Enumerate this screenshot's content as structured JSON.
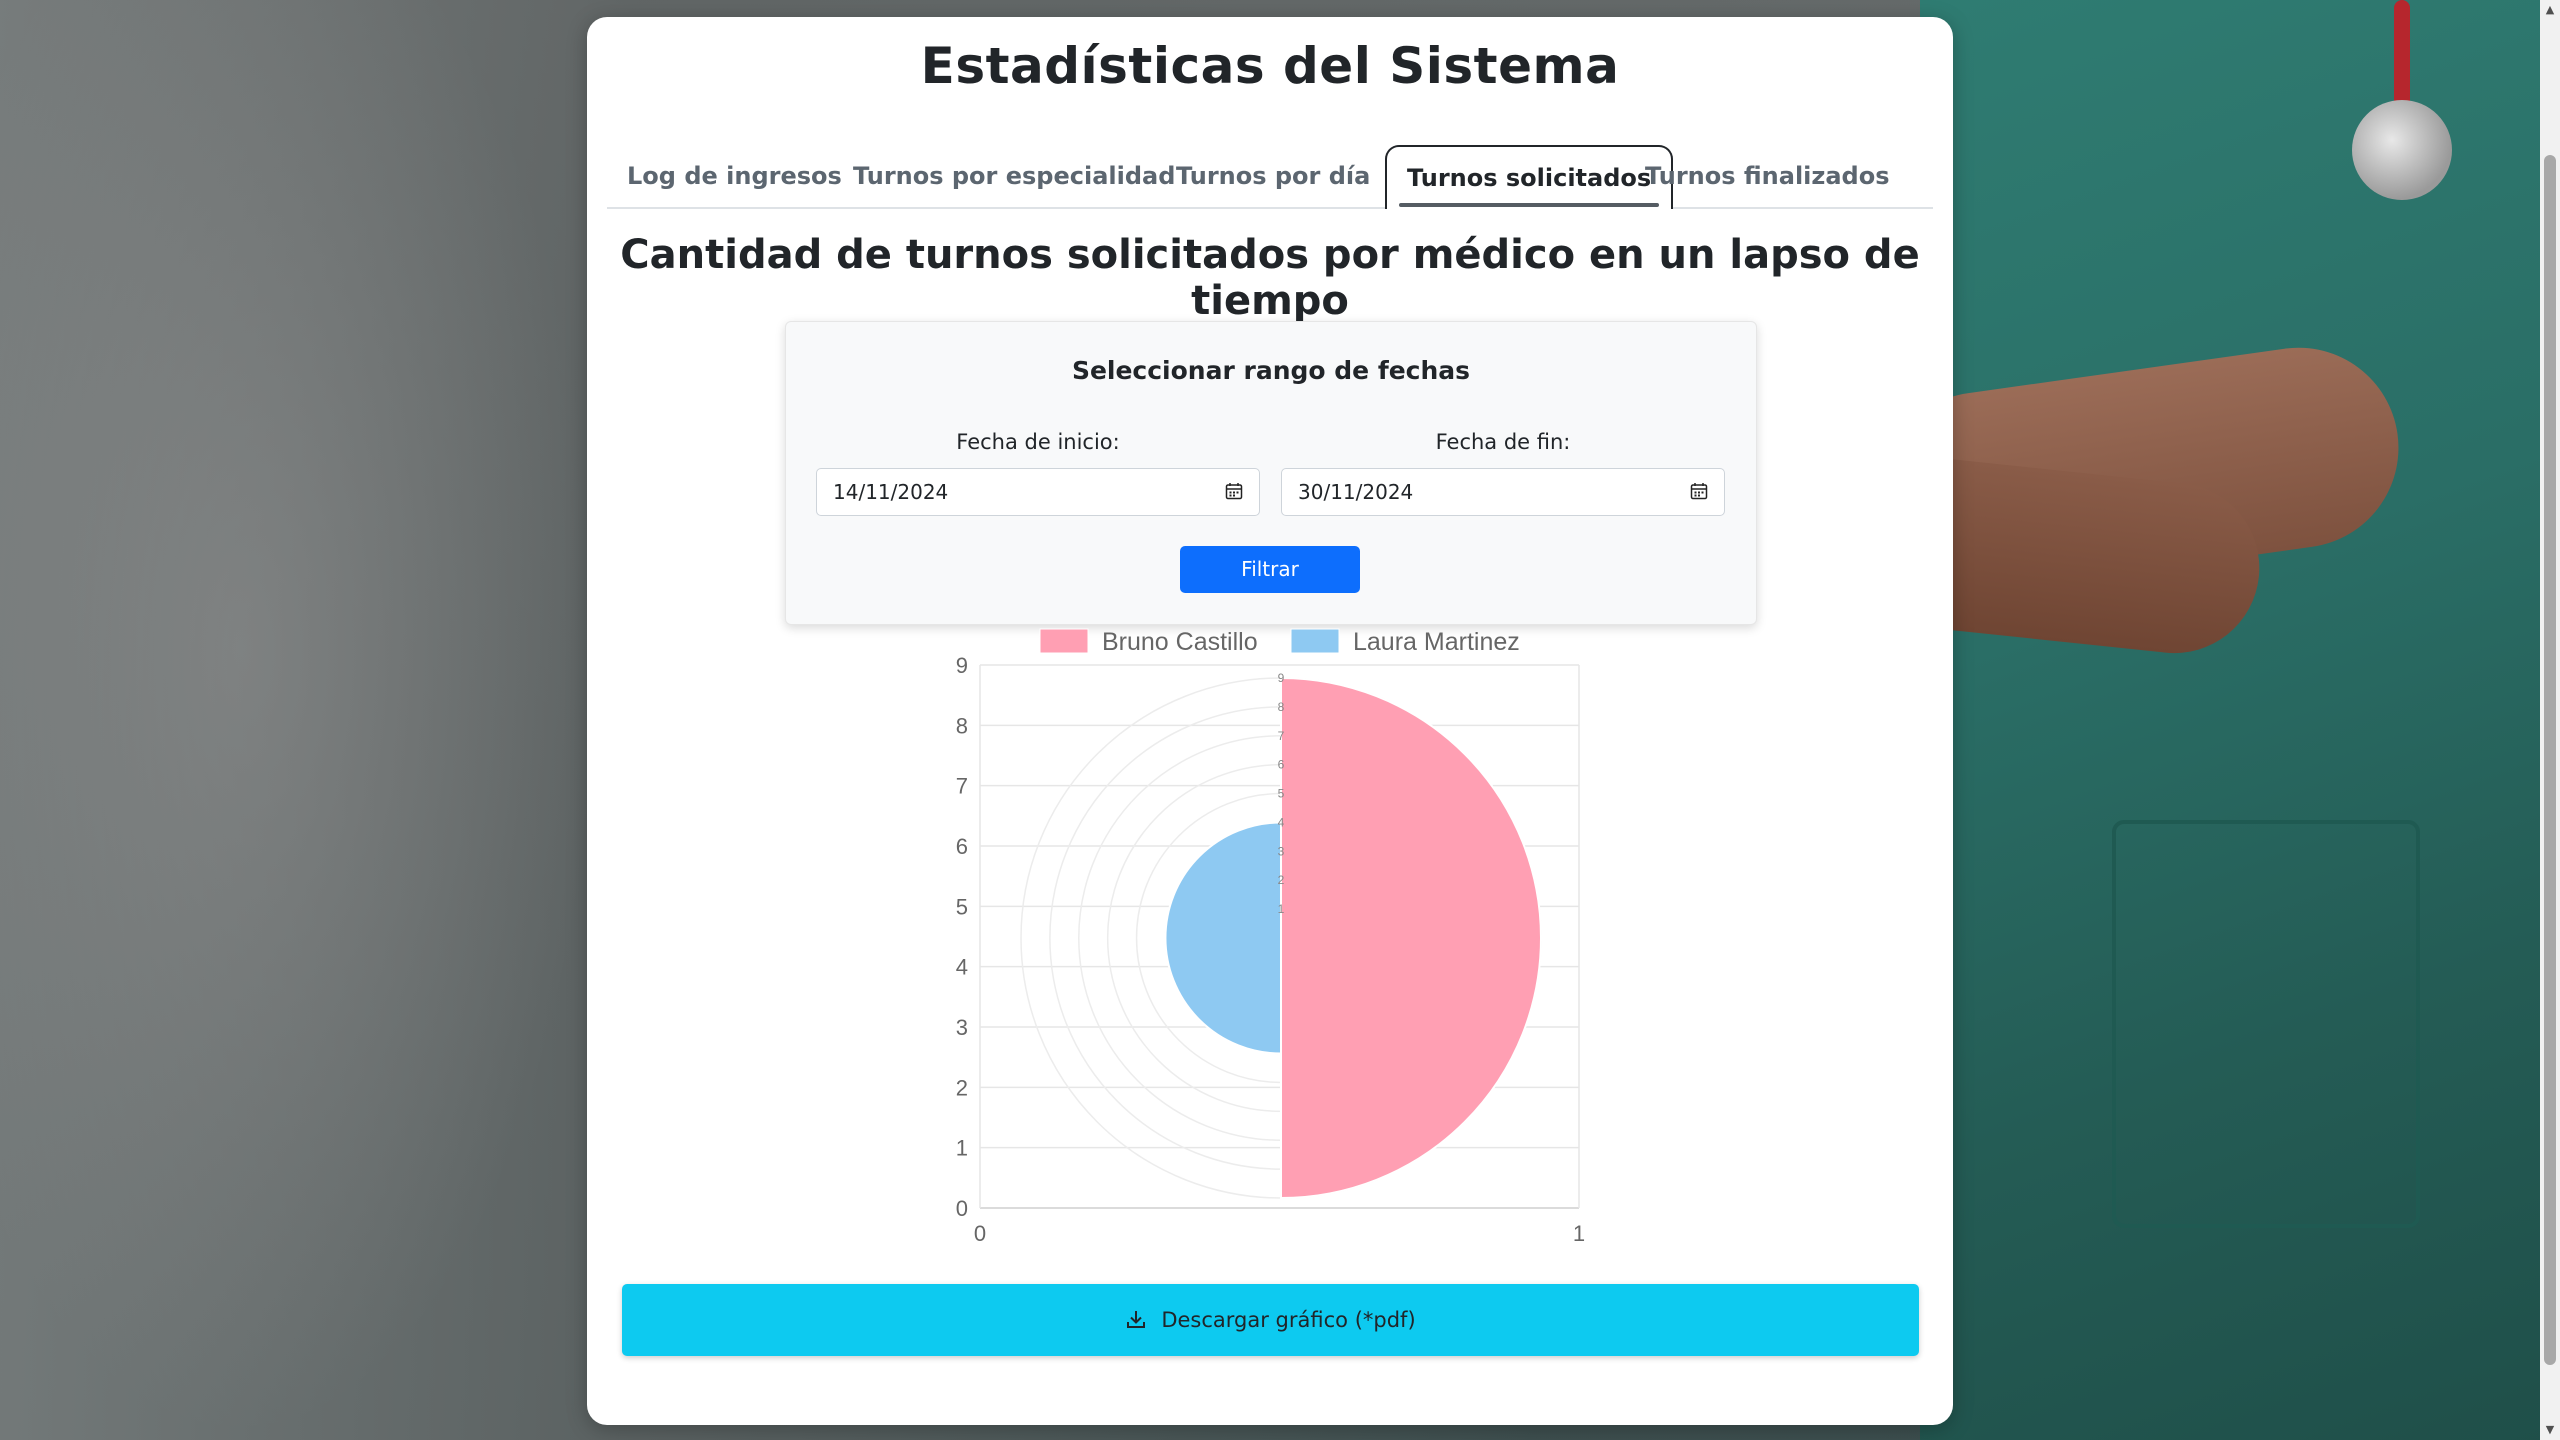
{
  "page": {
    "title": "Estadísticas del Sistema"
  },
  "tabs": [
    {
      "label": "Log de ingresos",
      "active": false
    },
    {
      "label": "Turnos por especialidad",
      "active": false
    },
    {
      "label": "Turnos por día",
      "active": false
    },
    {
      "label": "Turnos solicitados",
      "active": true
    },
    {
      "label": "Turnos finalizados",
      "active": false
    }
  ],
  "section": {
    "title": "Cantidad de turnos solicitados por médico en un lapso de tiempo"
  },
  "filter": {
    "title": "Seleccionar rango de fechas",
    "start_label": "Fecha de inicio:",
    "start_value": "14/11/2024",
    "end_label": "Fecha de fin:",
    "end_value": "30/11/2024",
    "button_label": "Filtrar"
  },
  "download": {
    "label": "Descargar gráfico (*pdf)"
  },
  "icons": {
    "calendar": "calendar-icon",
    "download": "download-icon"
  },
  "colors": {
    "primary": "#0d6efd",
    "info": "#0dcaf0",
    "series1": "#ff9fb3",
    "series2": "#8ec9f2"
  },
  "chart_data": {
    "type": "polarArea",
    "series": [
      {
        "name": "Bruno Castillo",
        "value": 9,
        "color": "#ff9fb3"
      },
      {
        "name": "Laura Martinez",
        "value": 4,
        "color": "#8ec9f2"
      }
    ],
    "radial_ticks": [
      "1",
      "2",
      "3",
      "4",
      "5",
      "6",
      "7",
      "8",
      "9"
    ],
    "y_ticks": [
      "0",
      "1",
      "2",
      "3",
      "4",
      "5",
      "6",
      "7",
      "8",
      "9"
    ],
    "x_ticks": [
      "0",
      "1"
    ],
    "ylim": [
      0,
      9
    ],
    "xlim": [
      0,
      1
    ],
    "legend": "top",
    "grid": true
  }
}
